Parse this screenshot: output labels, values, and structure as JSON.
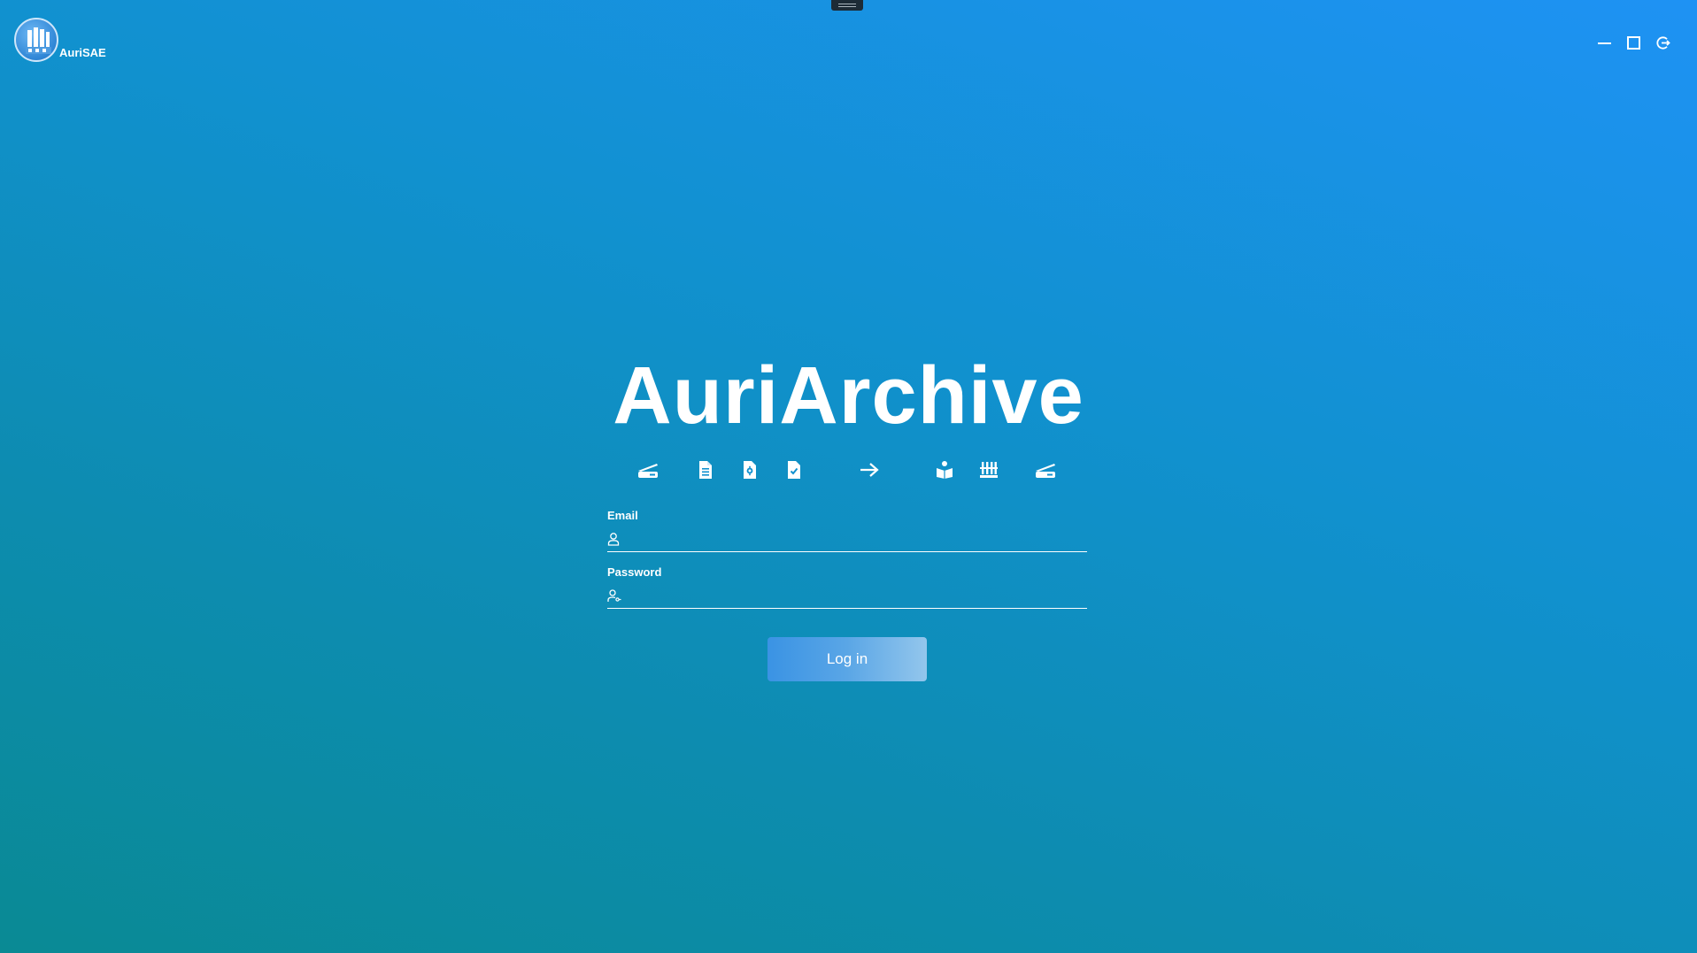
{
  "window": {
    "brand_name": "AuriSAE",
    "controls": {
      "minimize_icon": "minimize-icon",
      "maximize_icon": "maximize-icon",
      "close_icon": "exit-icon"
    }
  },
  "login": {
    "title": "AuriArchive",
    "feature_icons": [
      "scanner-icon",
      "document-icon",
      "document-settings-icon",
      "document-check-icon",
      "arrow-right-icon",
      "book-open-icon",
      "archive-columns-icon",
      "scanner-icon"
    ],
    "email_label": "Email",
    "email_value": "",
    "password_label": "Password",
    "password_value": "",
    "login_button": "Log in"
  },
  "colors": {
    "background_start": "#0a8a94",
    "background_end": "#1e92f4",
    "button_start": "#3a93e4",
    "button_end": "#93c6ec",
    "text": "#ffffff"
  }
}
